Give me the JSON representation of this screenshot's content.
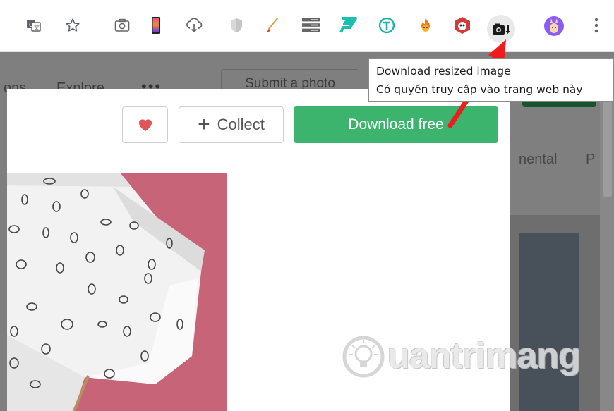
{
  "site_nav": {
    "item_partial": "ons",
    "explore": "Explore",
    "more": "•••",
    "submit": "Submit a photo"
  },
  "right_panel": {
    "text1": "nental",
    "text2": "P"
  },
  "modal": {
    "collect_label": "Collect",
    "download_label": "Download free"
  },
  "tooltip": {
    "line1": "Download resized image",
    "line2": "Có quyền truy cập vào trang web này"
  },
  "watermark": {
    "text": "uantrimang"
  },
  "colors": {
    "download_green": "#3cb46e",
    "heart_red": "#e25555",
    "arrow_red": "#ee1c1c",
    "photo_pink": "#c86478"
  },
  "icons": [
    "translate-icon",
    "star-icon",
    "screenshot-icon",
    "phone-icon",
    "cloud-download-icon",
    "shield-icon",
    "brush-icon",
    "server-icon",
    "f-logo-icon",
    "t-circle-icon",
    "fire-icon",
    "bug-icon",
    "camera-download-icon",
    "profile-avatar-icon",
    "menu-kebab-icon"
  ]
}
